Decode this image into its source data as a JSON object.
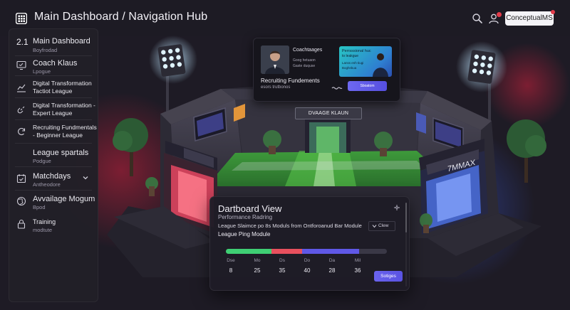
{
  "header": {
    "title": "Main Dashboard / Navigation Hub",
    "action_button": "ConceptualMS",
    "icons": [
      "grid-icon",
      "search-icon",
      "user-icon"
    ]
  },
  "sidebar": {
    "items": [
      {
        "num": "2.1",
        "label": "Main Dashboard",
        "sub": "Boyfrodad",
        "icon": "none"
      },
      {
        "label": "Coach Klaus",
        "sub": "Lpogue",
        "icon": "monitor-icon"
      },
      {
        "label": "Digital Transformation Tactiot League",
        "icon": "chart-icon"
      },
      {
        "label": "Digital Transformation - Expert League",
        "icon": "link-icon"
      },
      {
        "label": "Recruiting Fundmentals - Beginner League",
        "icon": "refresh-icon"
      },
      {
        "label": "League spartals",
        "sub": "Podgue",
        "icon": "none"
      },
      {
        "label": "Matchdays",
        "sub": "Antheodore",
        "icon": "calendar-check-icon",
        "expandable": true
      },
      {
        "label": "Avvailage Mogum",
        "sub": "Bpod",
        "icon": "globe-icon"
      },
      {
        "label": "Training",
        "sub": "modtute",
        "icon": "lock-icon"
      }
    ]
  },
  "video_card": {
    "person_name": "Coachtaages",
    "person_line1": "Goog hetuaon",
    "person_line2": "Gaste duquse",
    "promo_title": "Perrsssional huc",
    "promo_line1": "to leakgue",
    "promo_line2": "Lanss enh tiugi",
    "promo_line3": "Boghnkua",
    "recruiting_title": "Recruiting Fundements",
    "recruiting_sub": "esors trutbonos",
    "start_button": "Sboatom"
  },
  "stadium_sign": "DVAAGE KLAUN",
  "dashboard_panel": {
    "title": "Dartboard View",
    "subtitle": "Performance Radring",
    "line1": "League Slaimce po 8s Moduls from Ontforoanud Bar Module",
    "dropdown": "Clew",
    "line2": "League Ping Module",
    "progress": [
      {
        "fraction": 0.285,
        "color": "#3fcf74"
      },
      {
        "fraction": 0.19,
        "color": "#e8505e"
      },
      {
        "fraction": 0.355,
        "color": "#5f58e6"
      }
    ],
    "columns": [
      "Dse",
      "Mo",
      "Ds",
      "Do",
      "Da",
      "Mil"
    ],
    "values": [
      "8",
      "25",
      "35",
      "40",
      "28",
      "36"
    ],
    "button": "Sotiges"
  }
}
